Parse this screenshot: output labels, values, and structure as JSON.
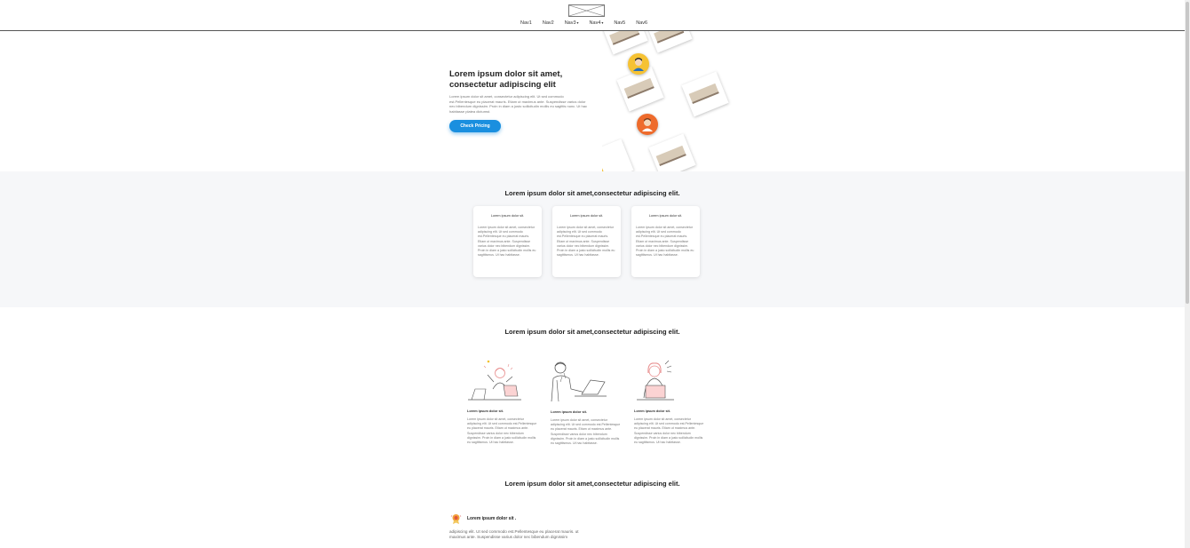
{
  "header": {
    "nav": [
      {
        "label": "Nav1",
        "caret": false
      },
      {
        "label": "Nav2",
        "caret": false
      },
      {
        "label": "Nav3",
        "caret": true
      },
      {
        "label": "Nav4",
        "caret": true
      },
      {
        "label": "Nav5",
        "caret": false
      },
      {
        "label": "Nav6",
        "caret": false
      }
    ],
    "caret_glyph": "▾"
  },
  "hero": {
    "title": "Lorem ipsum dolor sit amet, consectetur adipiscing elit",
    "body": "Lorem ipsum dolor sit amet, consectetur adipiscing elit. Ut sed commodo est.Pellentesque eu placerat mauris. Etiam ut maximus ante. Suspendisse varius dolor nec bibendum dignissim. Proin in diam a justo sollicitudin mollis eu sagittis nunc. Ut hac habitasse platea dictumst.",
    "cta_label": "Check Pricing",
    "accent_color": "#1a8fdf"
  },
  "features": {
    "heading": "Lorem ipsum dolor sit amet,consectetur adipiscing elit.",
    "cards": [
      {
        "title": "Lorem ipsum dolor sit.",
        "body": "Lorem ipsum dolor sit amet, consectetur adipiscing elit. Ut sed commodo est.Pellentesque eu placerat mauris. Etiam ut maximus ante. Suspendisse varius dolor nec bibendum dignissim. Proin in diam a justo sollicitudin mollis eu sagittismus. Ut hac habitasse."
      },
      {
        "title": "Lorem ipsum dolor sit.",
        "body": "Lorem ipsum dolor sit amet, consectetur adipiscing elit. Ut sed commodo est.Pellentesque eu placerat mauris. Etiam ut maximus ante. Suspendisse varius dolor nec bibendum dignissim. Proin in diam a justo sollicitudin mollis eu sagittismus. Ut hac habitasse."
      },
      {
        "title": "Lorem ipsum dolor sit.",
        "body": "Lorem ipsum dolor sit amet, consectetur adipiscing elit. Ut sed commodo est.Pellentesque eu placerat mauris. Etiam ut maximus ante. Suspendisse varius dolor nec bibendum dignissim. Proin in diam a justo sollicitudin mollis eu sagittismus. Ut hac habitasse."
      }
    ]
  },
  "illustrated": {
    "heading": "Lorem ipsum dolor sit amet,consectetur adipiscing elit.",
    "items": [
      {
        "icon": "woman-celebrating-illustration",
        "title": "Lorem ipsum dolor sit.",
        "body": "Lorem ipsum dolor sit amet, consectetur adipiscing elit. Ut sed commodo est.Pellentesque eu placerat mauris. Etiam ut maximus ante. Suspendisse varius dolor nec bibendum dignissim. Proin in diam a justo sollicitudin mollis eu sagittismus. Ut hac habitasse."
      },
      {
        "icon": "man-laptop-illustration",
        "title": "Lorem ipsum dolor sit.",
        "body": "Lorem ipsum dolor sit amet, consectetur adipiscing elit. Ut sed commodo est.Pellentesque eu placerat mauris. Etiam ut maximus ante. Suspendisse varius dolor nec bibendum dignissim. Proin in diam a justo sollicitudin mollis eu sagittismus. Ut hac habitasse."
      },
      {
        "icon": "woman-laptop-illustration",
        "title": "Lorem ipsum dolor sit.",
        "body": "Lorem ipsum dolor sit amet, consectetur adipiscing elit. Ut sed commodo est.Pellentesque eu placerat mauris. Etiam ut maximus ante. Suspendisse varius dolor nec bibendum dignissim. Proin in diam a justo sollicitudin mollis eu sagittismus. Ut hac habitasse."
      }
    ]
  },
  "section4": {
    "heading": "Lorem ipsum dolor sit amet,consectetur adipiscing elit.",
    "item_title": "Lorem ipsum dolor sit .",
    "item_body": "adipiscing elit. Ut sed commodo est.Pellentesque eu placerat mauris. ut maximus ante. Suspendisse varius dolor nec bibendum dignissim"
  }
}
